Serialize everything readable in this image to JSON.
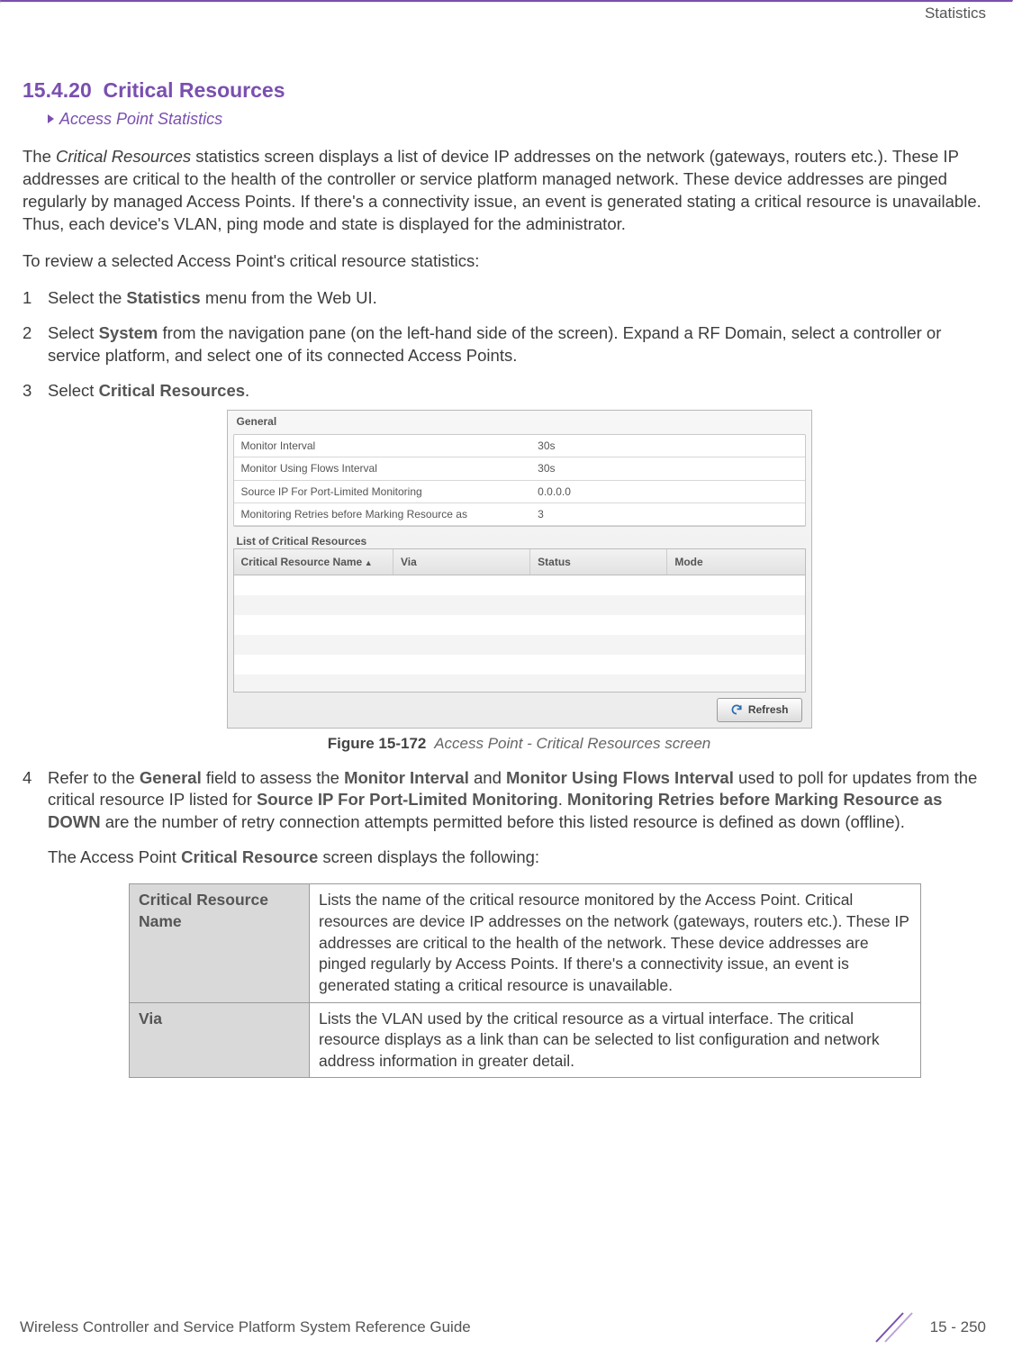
{
  "header": {
    "section_label": "Statistics"
  },
  "section": {
    "number": "15.4.20",
    "title": "Critical Resources",
    "breadcrumb": "Access Point Statistics"
  },
  "intro": {
    "p1_a": "The ",
    "p1_i": "Critical Resources",
    "p1_b": " statistics screen displays a list of device IP addresses on the network (gateways, routers etc.). These IP addresses are critical to the health of the controller or service platform managed network. These device addresses are pinged regularly by managed Access Points. If there's a connectivity issue, an event is generated stating a critical resource is unavailable. Thus, each device's VLAN, ping mode and state is displayed for the administrator.",
    "p2": "To review a selected Access Point's critical resource statistics:"
  },
  "steps": {
    "s1_a": "Select the ",
    "s1_b": "Statistics",
    "s1_c": " menu from the Web UI.",
    "s2_a": "Select ",
    "s2_b": "System",
    "s2_c": " from the navigation pane (on the left-hand side of the screen). Expand a RF Domain, select a controller or service platform, and select one of its connected Access Points.",
    "s3_a": "Select ",
    "s3_b": "Critical Resources",
    "s3_c": ".",
    "s4_a": "Refer to the ",
    "s4_b": "General",
    "s4_c": " field to assess the ",
    "s4_d": "Monitor Interval",
    "s4_e": " and ",
    "s4_f": "Monitor Using Flows Interval",
    "s4_g": " used to poll for updates from the critical resource IP listed for ",
    "s4_h": "Source IP For Port-Limited Monitoring",
    "s4_i": ". ",
    "s4_j": "Monitoring Retries before Marking Resource as DOWN",
    "s4_k": " are the number of retry connection attempts permitted before this listed resource is defined as down (offline).",
    "s4_p2_a": "The Access Point ",
    "s4_p2_b": "Critical Resource",
    "s4_p2_c": " screen displays the following:"
  },
  "figure": {
    "panel1_title": "General",
    "rows": [
      {
        "k": "Monitor Interval",
        "v": "30s"
      },
      {
        "k": "Monitor Using Flows Interval",
        "v": "30s"
      },
      {
        "k": "Source IP For Port-Limited Monitoring",
        "v": "0.0.0.0"
      },
      {
        "k": "Monitoring Retries before Marking Resource as",
        "v": "3"
      }
    ],
    "panel2_title": "List of Critical Resources",
    "cols": [
      "Critical Resource Name",
      "Via",
      "Status",
      "Mode"
    ],
    "refresh": "Refresh",
    "caption_no": "Figure 15-172",
    "caption_text": "Access Point - Critical Resources screen"
  },
  "deftable": [
    {
      "label": "Critical Resource Name",
      "desc": "Lists the name of the critical resource monitored by the Access Point. Critical resources are device IP addresses on the network (gateways, routers etc.). These IP addresses are critical to the health of the network. These device addresses are pinged regularly by Access Points. If there's a connectivity issue, an event is generated stating a critical resource is unavailable."
    },
    {
      "label": "Via",
      "desc": "Lists the VLAN used by the critical resource as a virtual interface. The critical resource displays as a link than can be selected to list configuration and network address information in greater detail."
    }
  ],
  "footer": {
    "left": "Wireless Controller and Service Platform System Reference Guide",
    "right": "15 - 250"
  }
}
